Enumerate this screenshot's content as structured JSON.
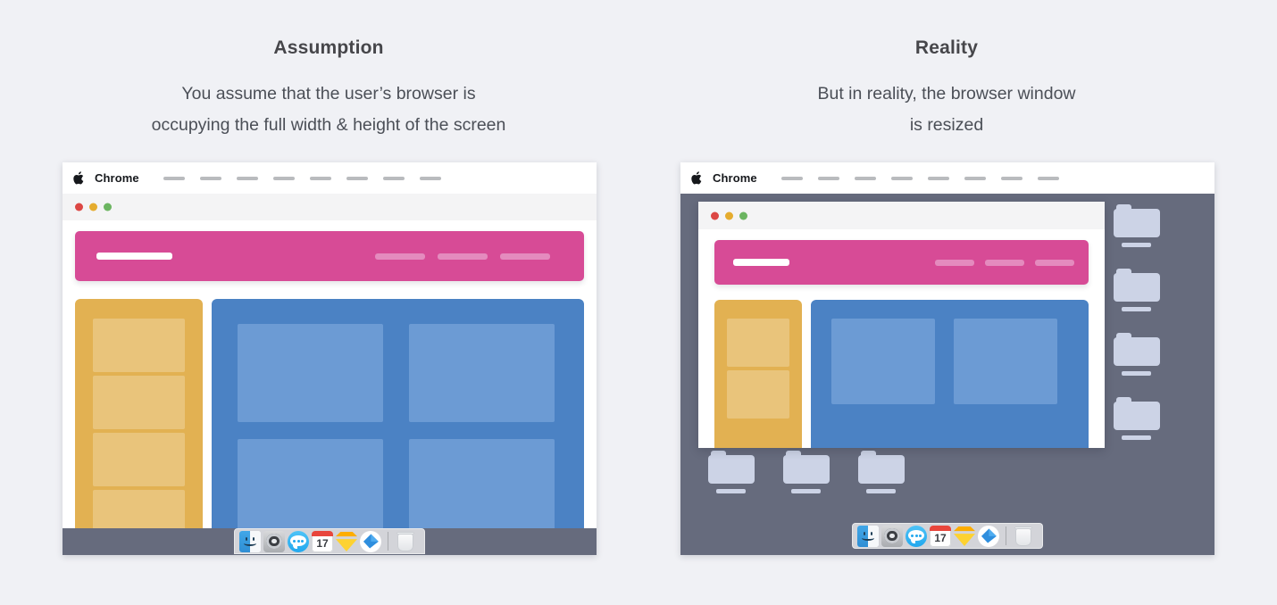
{
  "page": {
    "background": "#f0f1f5"
  },
  "columns": [
    {
      "id": "assumption",
      "title": "Assumption",
      "subtitle_line1": "You assume that the user’s browser is",
      "subtitle_line2": "occupying the full width & height of the screen"
    },
    {
      "id": "reality",
      "title": "Reality",
      "subtitle_line1": "But in reality, the browser window",
      "subtitle_line2": "is resized"
    }
  ],
  "menubar": {
    "apple_icon": "apple-logo-icon",
    "app_name": "Chrome",
    "menu_items_count": 8
  },
  "browser_window": {
    "traffic_lights": [
      {
        "name": "close-button",
        "color": "#dc4744"
      },
      {
        "name": "minimize-button",
        "color": "#e5ac2e"
      },
      {
        "name": "maximize-button",
        "color": "#6cb561"
      }
    ]
  },
  "webpage": {
    "header": {
      "color": "#d74b96",
      "logo_color": "#ffffff",
      "nav_color": "#e48bbe",
      "nav_items_count": 3
    },
    "sidebar": {
      "color": "#e2b152",
      "item_color": "#e9c47b",
      "items_count_full": 4,
      "items_count_resized": 2
    },
    "content": {
      "color": "#4b82c4",
      "card_color": "#6c9bd4",
      "cards_count_full": 4,
      "cards_count_resized": 2
    }
  },
  "desktop": {
    "color": "#666b7d",
    "folder_color": "#ccd3e6",
    "folders_right_column": 4,
    "folders_bottom_row": 3
  },
  "dock": {
    "background": "#ecedee",
    "icons": [
      {
        "name": "finder-icon",
        "label": "Finder"
      },
      {
        "name": "system-preferences-icon",
        "label": "System Preferences"
      },
      {
        "name": "messages-icon",
        "label": "Messages"
      },
      {
        "name": "calendar-icon",
        "label": "Calendar",
        "day": "17"
      },
      {
        "name": "sketch-icon",
        "label": "Sketch"
      },
      {
        "name": "safari-icon",
        "label": "Safari"
      },
      {
        "name": "trash-icon",
        "label": "Trash"
      }
    ]
  }
}
